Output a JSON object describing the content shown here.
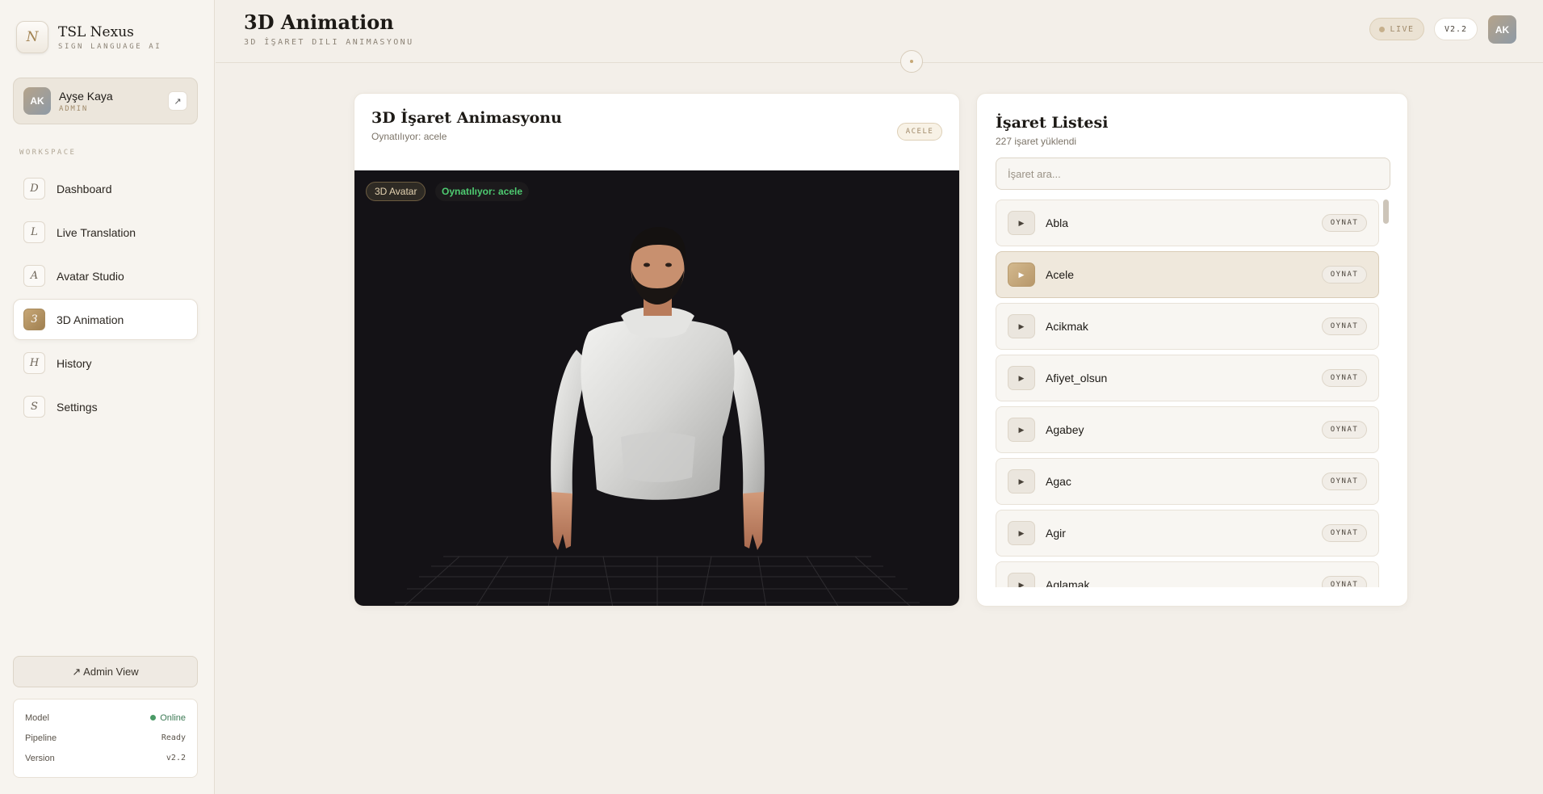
{
  "brand": {
    "logo_letter": "N",
    "name": "TSL Nexus",
    "subtitle": "SIGN LANGUAGE AI"
  },
  "user": {
    "initials": "AK",
    "name": "Ayşe Kaya",
    "role": "ADMIN",
    "open_icon": "↗"
  },
  "sidebar": {
    "section_label": "WORKSPACE",
    "items": [
      {
        "letter": "D",
        "label": "Dashboard",
        "active": false
      },
      {
        "letter": "L",
        "label": "Live Translation",
        "active": false
      },
      {
        "letter": "A",
        "label": "Avatar Studio",
        "active": false
      },
      {
        "letter": "3",
        "label": "3D Animation",
        "active": true
      },
      {
        "letter": "H",
        "label": "History",
        "active": false
      },
      {
        "letter": "S",
        "label": "Settings",
        "active": false
      }
    ],
    "admin_view_label": "↗ Admin View",
    "status": [
      {
        "key": "Model",
        "value": "Online"
      },
      {
        "key": "Pipeline",
        "value": "Ready"
      },
      {
        "key": "Version",
        "value": "v2.2"
      }
    ]
  },
  "header": {
    "title": "3D Animation",
    "subtitle": "3D İŞARET DILI ANIMASYONU",
    "live_label": "LIVE",
    "version": "V2.2",
    "avatar_initials": "AK"
  },
  "animation": {
    "title": "3D İşaret Animasyonu",
    "subtitle": "Oynatılıyor: acele",
    "badge": "ACELE",
    "chip_avatar": "3D Avatar",
    "chip_playing": "Oynatılıyor: acele"
  },
  "sign_list": {
    "title": "İşaret Listesi",
    "count_text": "227 işaret yüklendi",
    "search_placeholder": "İşaret ara...",
    "play_label": "OYNAT",
    "active_index": 1,
    "items": [
      "Abla",
      "Acele",
      "Acikmak",
      "Afiyet_olsun",
      "Agabey",
      "Agac",
      "Agir",
      "Aglamak"
    ]
  },
  "colors": {
    "accent": "#b7976a",
    "background": "#f3efe9",
    "viewport": "#141216",
    "playing_green": "#4ecb71",
    "online_green": "#4a9a66"
  }
}
